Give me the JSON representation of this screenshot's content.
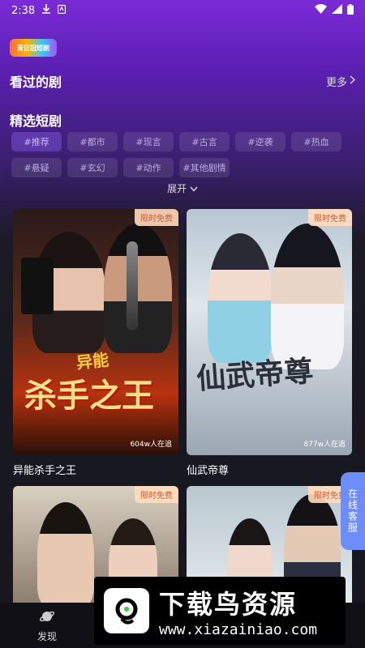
{
  "status_bar": {
    "time": "2:38"
  },
  "logo": {
    "text": "青日冠短剧"
  },
  "watched": {
    "title": "看过的剧",
    "more": "更多"
  },
  "picks": {
    "title": "精选短剧",
    "tags": [
      "#推荐",
      "#都市",
      "#现言",
      "#古言",
      "#逆袭",
      "#热血",
      "#悬疑",
      "#玄幻",
      "#动作",
      "#其他剧情"
    ],
    "expand": "展开"
  },
  "cards": [
    {
      "badge": "限时免费",
      "poster_top": "异能",
      "poster_main": "杀手之王",
      "views": "604w人在追",
      "title": "异能杀手之王"
    },
    {
      "badge": "限时免费",
      "poster_main": "仙武帝尊",
      "views": "877w人在追",
      "title": "仙武帝尊"
    },
    {
      "badge": "限时免费"
    },
    {
      "badge": "限时免费"
    }
  ],
  "customer_service": {
    "label": "在线客服"
  },
  "tabbar": {
    "discover": "发现"
  },
  "watermark": {
    "title": "下载鸟资源",
    "url": "www.xiazainiao.com"
  },
  "colors": {
    "accent": "#7a2bd6",
    "badge_text": "#d35a2d",
    "service": "#6d8dff"
  }
}
